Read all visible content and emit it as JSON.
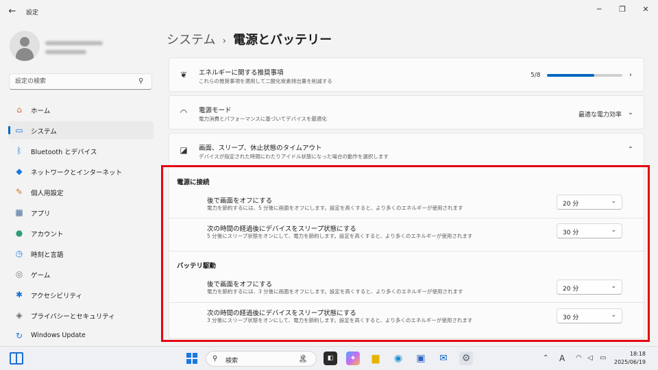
{
  "window": {
    "app_title": "設定",
    "back_icon": "back-arrow-icon",
    "controls": {
      "minimize": "─",
      "maximize": "❐",
      "close": "✕"
    }
  },
  "sidebar": {
    "search_placeholder": "設定の検索",
    "items": [
      {
        "label": "ホーム",
        "icon": "home-icon",
        "glyph": "⌂",
        "color": "#d0693a"
      },
      {
        "label": "システム",
        "icon": "system-icon",
        "glyph": "▭",
        "color": "#1a78e0",
        "active": true
      },
      {
        "label": "Bluetooth とデバイス",
        "icon": "bluetooth-icon",
        "glyph": "ᛒ",
        "color": "#1a78e0"
      },
      {
        "label": "ネットワークとインターネット",
        "icon": "network-icon",
        "glyph": "◆",
        "color": "#1a78e0"
      },
      {
        "label": "個人用設定",
        "icon": "brush-icon",
        "glyph": "✎",
        "color": "#c47b2b"
      },
      {
        "label": "アプリ",
        "icon": "apps-icon",
        "glyph": "▦",
        "color": "#4a6c9b"
      },
      {
        "label": "アカウント",
        "icon": "account-icon",
        "glyph": "●",
        "color": "#2e9e7a"
      },
      {
        "label": "時刻と言語",
        "icon": "time-language-icon",
        "glyph": "◷",
        "color": "#1a78e0"
      },
      {
        "label": "ゲーム",
        "icon": "game-icon",
        "glyph": "◎",
        "color": "#7a7a7a"
      },
      {
        "label": "アクセシビリティ",
        "icon": "accessibility-icon",
        "glyph": "✱",
        "color": "#1a6fd1"
      },
      {
        "label": "プライバシーとセキュリティ",
        "icon": "shield-icon",
        "glyph": "◈",
        "color": "#6b6b6b"
      },
      {
        "label": "Windows Update",
        "icon": "update-icon",
        "glyph": "↻",
        "color": "#1a78e0"
      }
    ]
  },
  "main": {
    "breadcrumb_parent": "システム",
    "breadcrumb_sep": "›",
    "breadcrumb_current": "電源とバッテリー",
    "energy": {
      "title": "エネルギーに関する推奨事項",
      "desc": "これらの推奨事項を適用して二酸化炭素排出量を削減する",
      "progress_text": "5/8",
      "progress_fraction": 0.625
    },
    "power_mode": {
      "title": "電源モード",
      "desc": "電力消費とパフォーマンスに基づいてデバイスを最適化",
      "value": "最適な電力効率"
    },
    "timeouts": {
      "title": "画面、スリープ、休止状態のタイムアウト",
      "desc": "デバイスが指定された時間にわたりアイドル状態になった場合の動作を選択します",
      "plugged_in": {
        "section_title": "電源に接続",
        "screen_off_title": "後で画面をオフにする",
        "screen_off_desc": "電力を節約するには、5 分後に画面をオフにします。設定を高くすると、より多くのエネルギーが使用されます",
        "screen_off_value": "20 分",
        "sleep_title": "次の時間の経過後にデバイスをスリープ状態にする",
        "sleep_desc": "5 分後にスリープ状態をオンにして、電力を節約します。設定を高くすると、より多くのエネルギーが使用されます",
        "sleep_value": "30 分"
      },
      "battery": {
        "section_title": "バッテリ駆動",
        "screen_off_title": "後で画面をオフにする",
        "screen_off_desc": "電力を節約するには、3 分後に画面をオフにします。設定を高くすると、より多くのエネルギーが使用されます",
        "screen_off_value": "20 分",
        "sleep_title": "次の時間の経過後にデバイスをスリープ状態にする",
        "sleep_desc": "3 分後にスリープ状態をオンにして、電力を節約します。設定を高くすると、より多くのエネルギーが使用されます",
        "sleep_value": "30 分"
      }
    }
  },
  "taskbar": {
    "search_label": "検索",
    "apps": [
      {
        "name": "file-explorer-icon",
        "glyph": "▆",
        "color": "#e8b200"
      },
      {
        "name": "edge-icon",
        "glyph": "◉",
        "color": "#1f8fd6"
      },
      {
        "name": "store-icon",
        "glyph": "▣",
        "color": "#2b63c6"
      },
      {
        "name": "outlook-icon",
        "glyph": "✉",
        "color": "#0a64c8"
      },
      {
        "name": "settings-icon",
        "glyph": "⚙",
        "color": "#5f6670"
      }
    ],
    "tray": {
      "chevron": "⌃",
      "ime": "A"
    },
    "clock_time": "18:18",
    "clock_date": "2025/06/19",
    "accent_color": "#0067c0",
    "highlight_color": "#e60012"
  }
}
